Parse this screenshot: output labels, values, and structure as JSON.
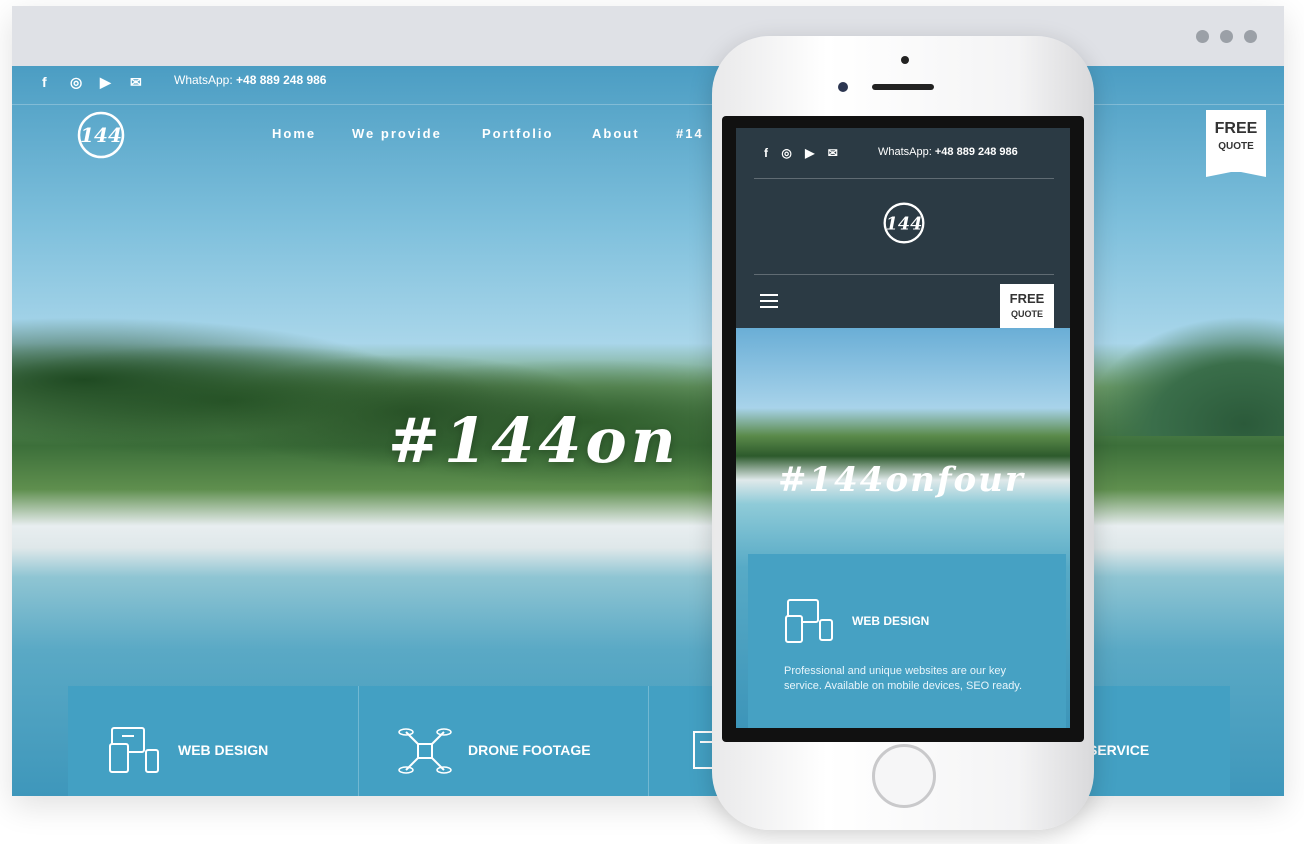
{
  "browser": {
    "window_dots": 3
  },
  "site": {
    "topbar": {
      "social_icons": [
        "facebook-icon",
        "instagram-icon",
        "youtube-icon",
        "mail-icon"
      ],
      "whatsapp_label": "WhatsApp:",
      "whatsapp_number": "+48 889 248 986"
    },
    "logo_text": "144",
    "nav": [
      "Home",
      "We provide",
      "Portfolio",
      "About",
      "#14"
    ],
    "free_quote": {
      "line1": "FREE",
      "line2": "QUOTE"
    },
    "hero_hashtag": "#144on",
    "services": [
      {
        "label": "WEB DESIGN",
        "icon": "devices-icon"
      },
      {
        "label": "DRONE FOOTAGE",
        "icon": "drone-icon"
      },
      {
        "label": "",
        "icon": "web-icon"
      },
      {
        "label": "SERVICE",
        "icon": ""
      }
    ]
  },
  "mobile": {
    "topbar": {
      "whatsapp_label": "WhatsApp:",
      "whatsapp_number": "+48 889 248 986"
    },
    "logo_text": "144",
    "free_quote": {
      "line1": "FREE",
      "line2": "QUOTE"
    },
    "hero_hashtag": "#144onfour",
    "card": {
      "title": "WEB DESIGN",
      "description": "Professional and unique websites are our key service. Available on mobile devices, SEO ready."
    }
  },
  "colors": {
    "accent": "#43a0c3",
    "header_dark": "#2b3a44",
    "titlebar": "#dfe1e6"
  }
}
